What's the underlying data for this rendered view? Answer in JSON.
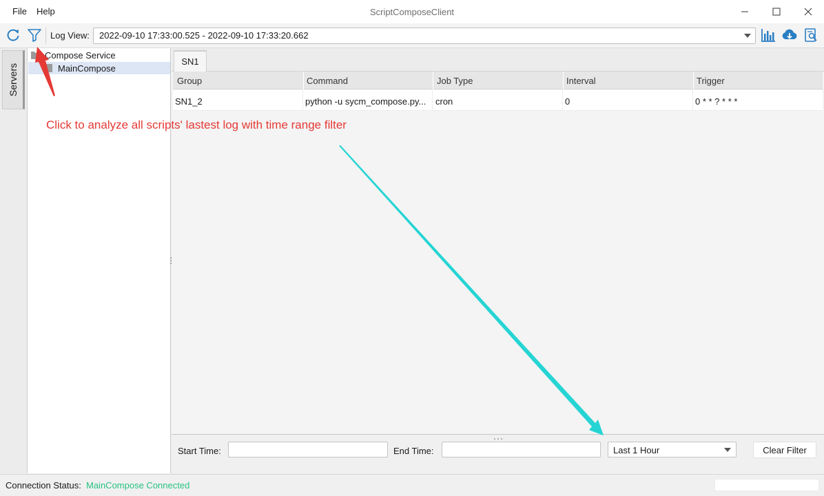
{
  "window": {
    "title": "ScriptComposeClient",
    "menu": [
      "File",
      "Help"
    ]
  },
  "toolbar": {
    "refresh_icon": "refresh-icon",
    "filter_icon": "filter-icon",
    "log_view_label": "Log View:",
    "log_view_value": "2022-09-10 17:33:00.525 - 2022-09-10 17:33:20.662",
    "right_icons": [
      "chart-icon",
      "cloud-download-icon",
      "search-document-icon"
    ]
  },
  "sidebar": {
    "tab_label": "Servers",
    "tree": {
      "root": "Compose Service",
      "child": "MainCompose"
    }
  },
  "tabs": [
    "SN1"
  ],
  "table": {
    "columns": [
      "Group",
      "Command",
      "Job Type",
      "Interval",
      "Trigger"
    ],
    "rows": [
      [
        "SN1_2",
        "python -u sycm_compose.py...",
        "cron",
        "0",
        "0 * * ? * * *"
      ]
    ]
  },
  "annotation": "Click to analyze all scripts' lastest log with time range filter",
  "filter": {
    "start_label": "Start Time:",
    "end_label": "End Time:",
    "start_value": "",
    "end_value": "",
    "range_value": "Last 1 Hour",
    "clear_label": "Clear Filter"
  },
  "status": {
    "label": "Connection Status:",
    "value": "MainCompose Connected"
  },
  "colors": {
    "annotation": "#e53935",
    "arrow_red": "#e53935",
    "arrow_cyan": "#26d4d4",
    "status_connected": "#26c281",
    "icon_blue": "#2a7ec4"
  }
}
